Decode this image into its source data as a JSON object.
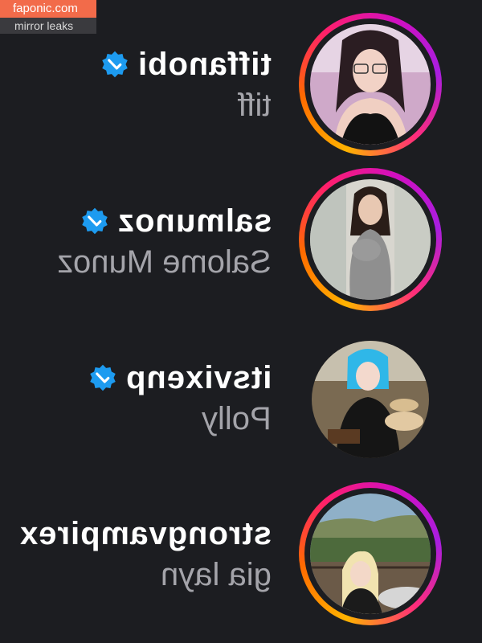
{
  "watermark": {
    "brand": "faponic.com",
    "subtitle": "mirror leaks"
  },
  "accounts": [
    {
      "handle": "tiffanobi",
      "display_name": "tiff",
      "verified": true,
      "has_story_ring": true
    },
    {
      "handle": "salmunoz",
      "display_name": "Salome Munoz",
      "verified": true,
      "has_story_ring": true
    },
    {
      "handle": "itsvixenp",
      "display_name": "Polly",
      "verified": true,
      "has_story_ring": false
    },
    {
      "handle": "strongvampirex",
      "display_name": "gia layn",
      "verified": false,
      "has_story_ring": true
    }
  ],
  "colors": {
    "background": "#1c1d21",
    "verified": "#1d9bf0",
    "handle": "#ffffff",
    "display_name": "#a4a4aa"
  }
}
